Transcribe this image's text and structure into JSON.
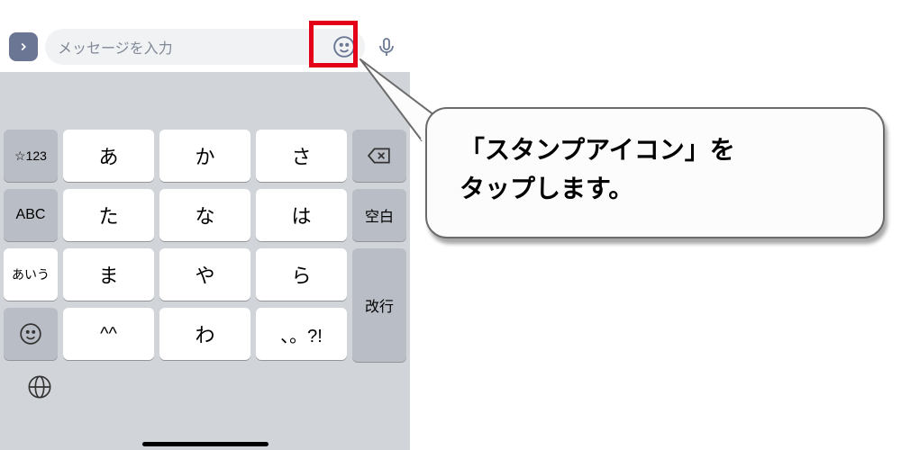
{
  "input_bar": {
    "placeholder": "メッセージを入力"
  },
  "keyboard": {
    "side": {
      "num": "☆123",
      "abc": "ABC",
      "kana": "あいう",
      "space": "空白",
      "return": "改行"
    },
    "rows": [
      [
        "あ",
        "か",
        "さ"
      ],
      [
        "た",
        "な",
        "は"
      ],
      [
        "ま",
        "や",
        "ら"
      ],
      [
        "^^",
        "わ",
        "、。?!"
      ]
    ]
  },
  "callout": {
    "line1": "「スタンプアイコン」を",
    "line2": "タップします。"
  }
}
